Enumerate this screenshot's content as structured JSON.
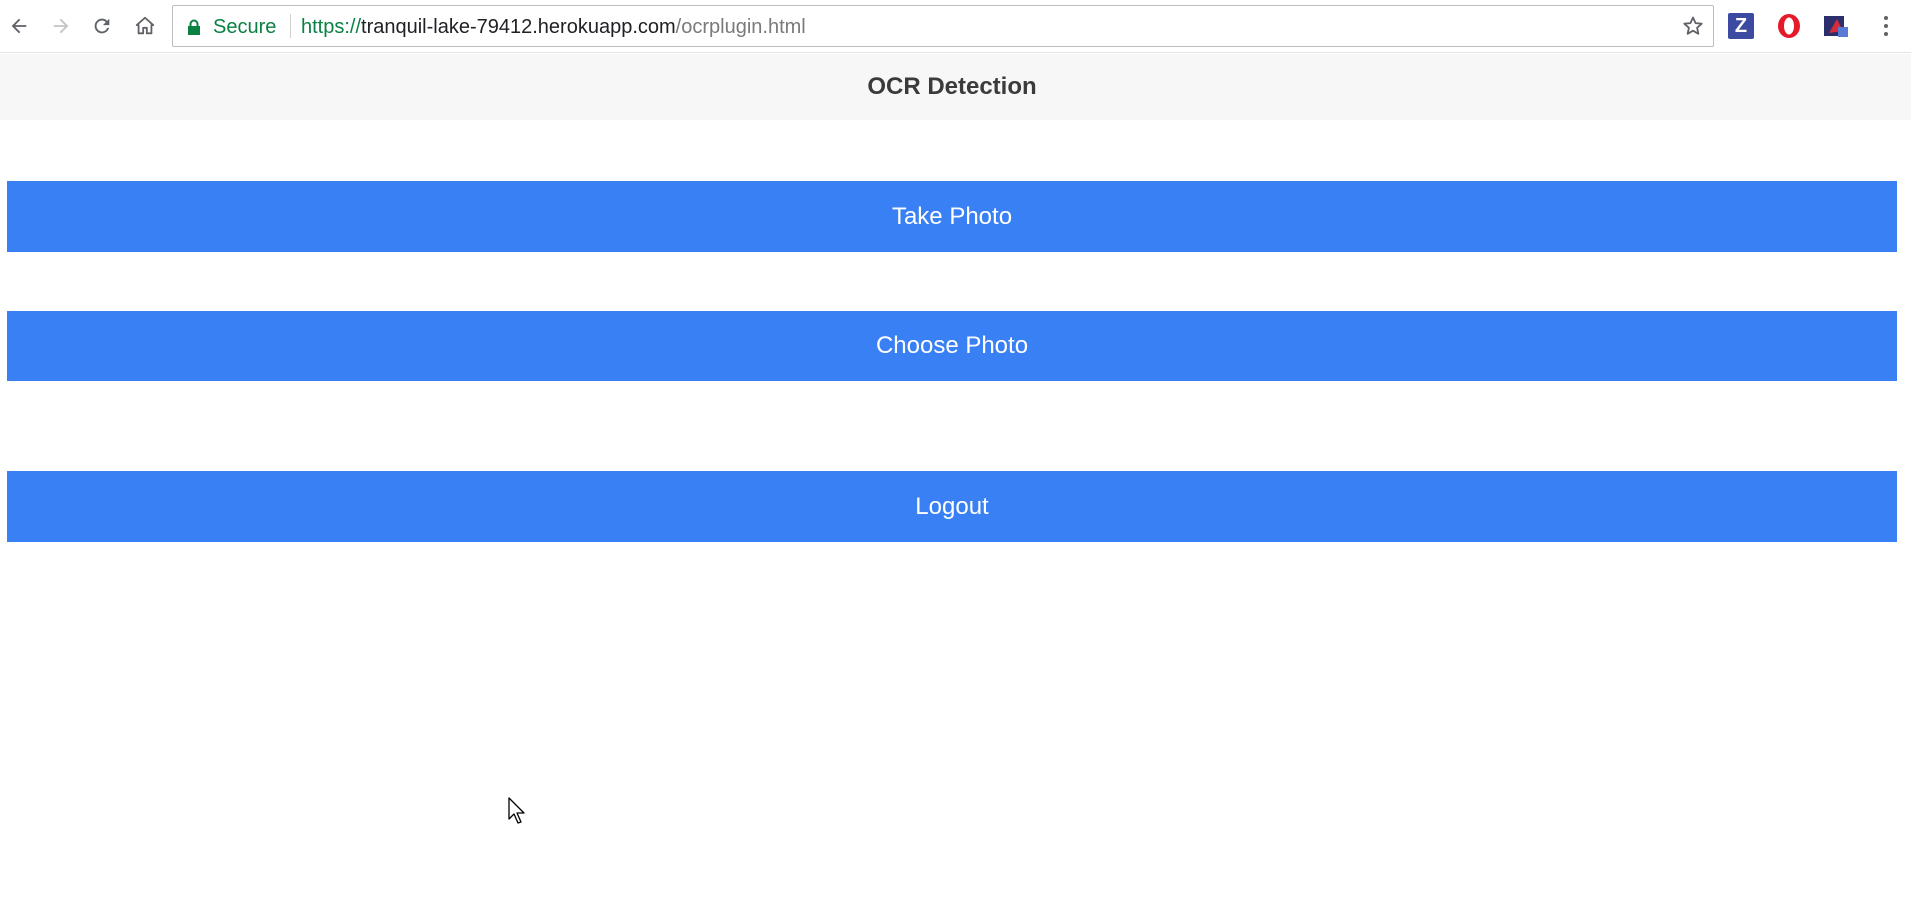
{
  "browser": {
    "secure_label": "Secure",
    "url_scheme": "https://",
    "url_host": "tranquil-lake-79412.herokuapp.com",
    "url_path": "/ocrplugin.html",
    "extensions": [
      {
        "label": "Z",
        "icon": "zotero-icon"
      },
      {
        "icon": "opera-icon"
      },
      {
        "icon": "shield-extension-icon"
      }
    ]
  },
  "page": {
    "title": "OCR Detection",
    "buttons": {
      "take_photo": "Take Photo",
      "choose_photo": "Choose Photo",
      "logout": "Logout"
    }
  },
  "colors": {
    "button_blue": "#3980f4",
    "header_bg": "#f7f7f7",
    "secure_green": "#0b8043"
  }
}
